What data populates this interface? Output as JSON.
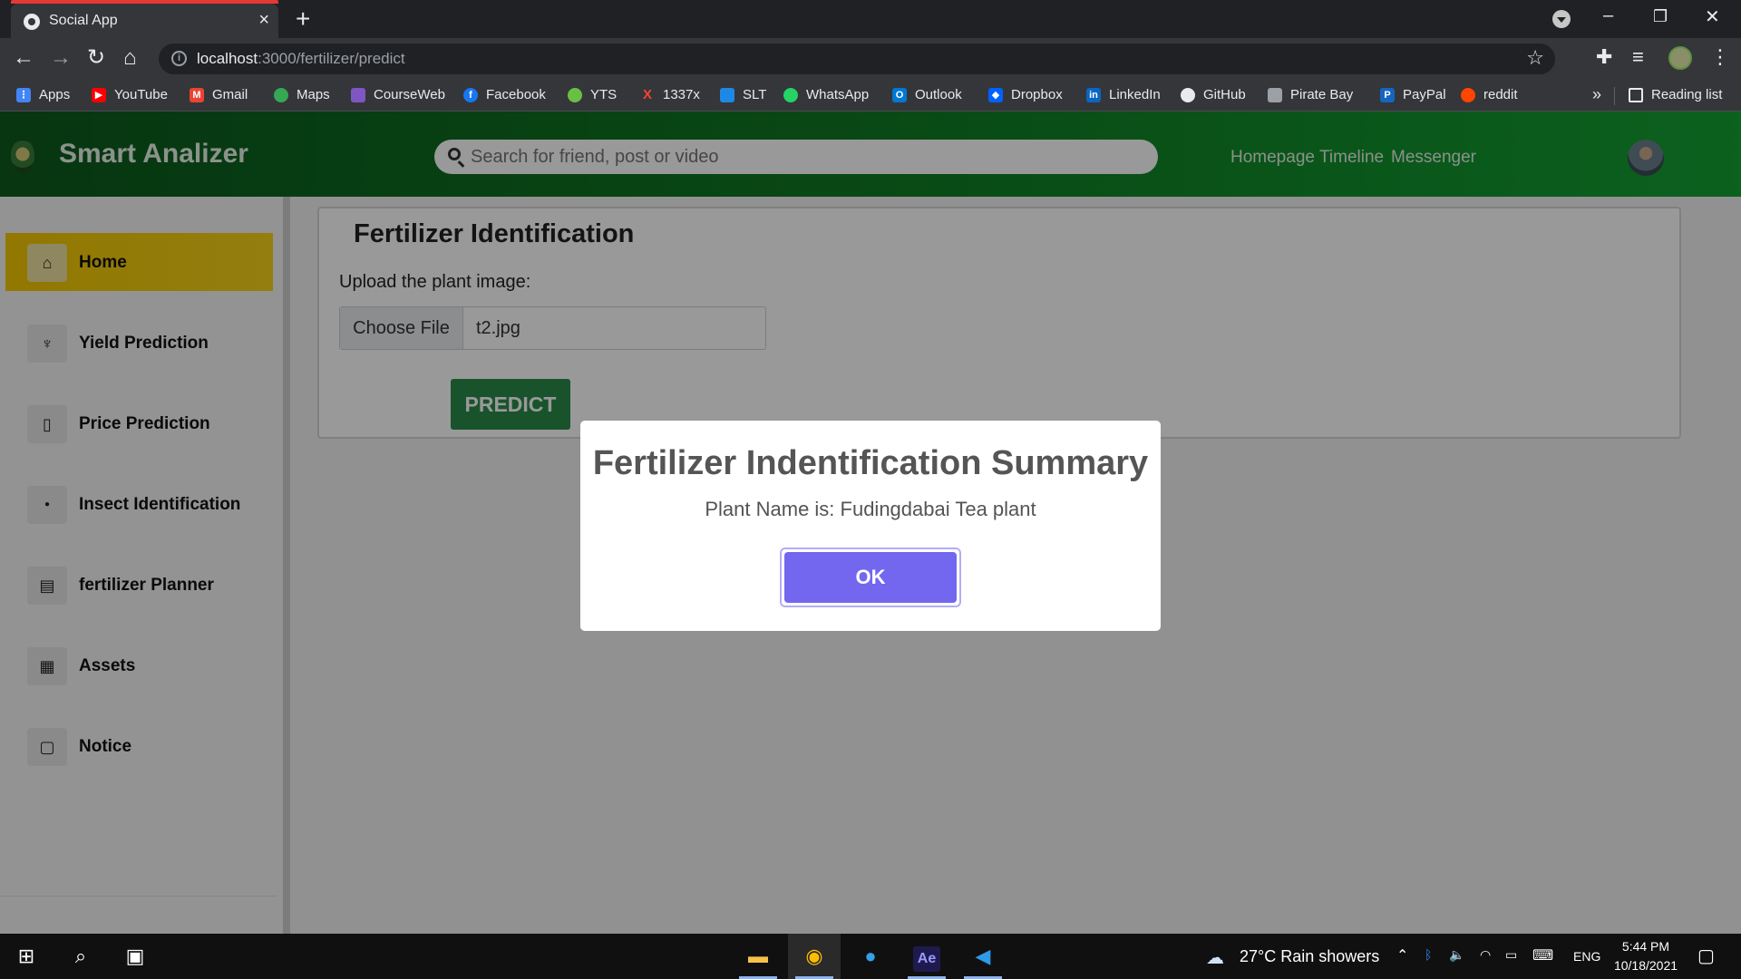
{
  "browser": {
    "tab_title": "Social App",
    "tab_close": "×",
    "new_tab": "+",
    "url_host": "localhost",
    "url_rest": ":3000/fertilizer/predict",
    "reading_list": "Reading list",
    "more_bookmarks": "»",
    "window_controls": {
      "minimize": "–",
      "restore": "❐",
      "close": "✕"
    },
    "bookmarks": [
      {
        "label": "Apps",
        "icon": "apps-grid-icon",
        "color": "#4285f4"
      },
      {
        "label": "YouTube",
        "icon": "youtube-icon",
        "color": "#ff0000"
      },
      {
        "label": "Gmail",
        "icon": "gmail-icon",
        "color": "#ea4335"
      },
      {
        "label": "Maps",
        "icon": "maps-pin-icon",
        "color": "#34a853"
      },
      {
        "label": "CourseWeb",
        "icon": "courseweb-icon",
        "color": "#7e57c2"
      },
      {
        "label": "Facebook",
        "icon": "facebook-icon",
        "color": "#1877f2"
      },
      {
        "label": "YTS",
        "icon": "yts-icon",
        "color": "#6ac045"
      },
      {
        "label": "1337x",
        "icon": "x-icon",
        "color": "#f44336"
      },
      {
        "label": "SLT",
        "icon": "slt-icon",
        "color": "#1e88e5"
      },
      {
        "label": "WhatsApp",
        "icon": "whatsapp-icon",
        "color": "#25d366"
      },
      {
        "label": "Outlook",
        "icon": "outlook-icon",
        "color": "#0078d4"
      },
      {
        "label": "Dropbox",
        "icon": "dropbox-icon",
        "color": "#0061ff"
      },
      {
        "label": "LinkedIn",
        "icon": "linkedin-icon",
        "color": "#0a66c2"
      },
      {
        "label": "GitHub",
        "icon": "github-icon",
        "color": "#e8eaed"
      },
      {
        "label": "Pirate Bay",
        "icon": "pirate-bay-icon",
        "color": "#9aa0a6"
      },
      {
        "label": "PayPal",
        "icon": "paypal-icon",
        "color": "#1565c0"
      },
      {
        "label": "reddit",
        "icon": "reddit-icon",
        "color": "#ff4500"
      }
    ]
  },
  "app": {
    "brand": "Smart Analizer",
    "search_placeholder": "Search for friend, post or video",
    "nav": {
      "homepage": "Homepage",
      "timeline": "Timeline",
      "messenger": "Messenger"
    },
    "sidebar": [
      {
        "label": "Home",
        "icon": "⌂",
        "icon_name": "home-icon",
        "active": true
      },
      {
        "label": "Yield Prediction",
        "icon": "♆",
        "icon_name": "yield-icon",
        "active": false
      },
      {
        "label": "Price Prediction",
        "icon": "▯",
        "icon_name": "book-icon",
        "active": false
      },
      {
        "label": "Insect Identification",
        "icon": "●",
        "icon_name": "insect-icon",
        "active": false
      },
      {
        "label": "fertilizer Planner",
        "icon": "▤",
        "icon_name": "document-icon",
        "active": false
      },
      {
        "label": "Assets",
        "icon": "▦",
        "icon_name": "assets-icon",
        "active": false
      },
      {
        "label": "Notice",
        "icon": "▢",
        "icon_name": "notice-icon",
        "active": false
      }
    ],
    "card": {
      "title": "Fertilizer Identification",
      "upload_label": "Upload the plant image:",
      "choose_file": "Choose File",
      "file_name": "t2.jpg",
      "predict": "PREDICT"
    },
    "modal": {
      "title": "Fertilizer Indentification Summary",
      "text": "Plant Name is: Fudingdabai Tea plant",
      "ok": "OK"
    }
  },
  "taskbar": {
    "weather": "27°C  Rain showers",
    "language": "ENG",
    "time": "5:44 PM",
    "date": "10/18/2021",
    "apps": [
      "file-explorer-icon",
      "chrome-icon",
      "edge-icon",
      "after-effects-icon",
      "vscode-icon"
    ],
    "ae_label": "Ae"
  },
  "colors": {
    "header_green": "#0f7a23",
    "active_sidebar": "#f3c800",
    "predict_button": "#2a8a4a",
    "ok_button": "#7367f0"
  }
}
